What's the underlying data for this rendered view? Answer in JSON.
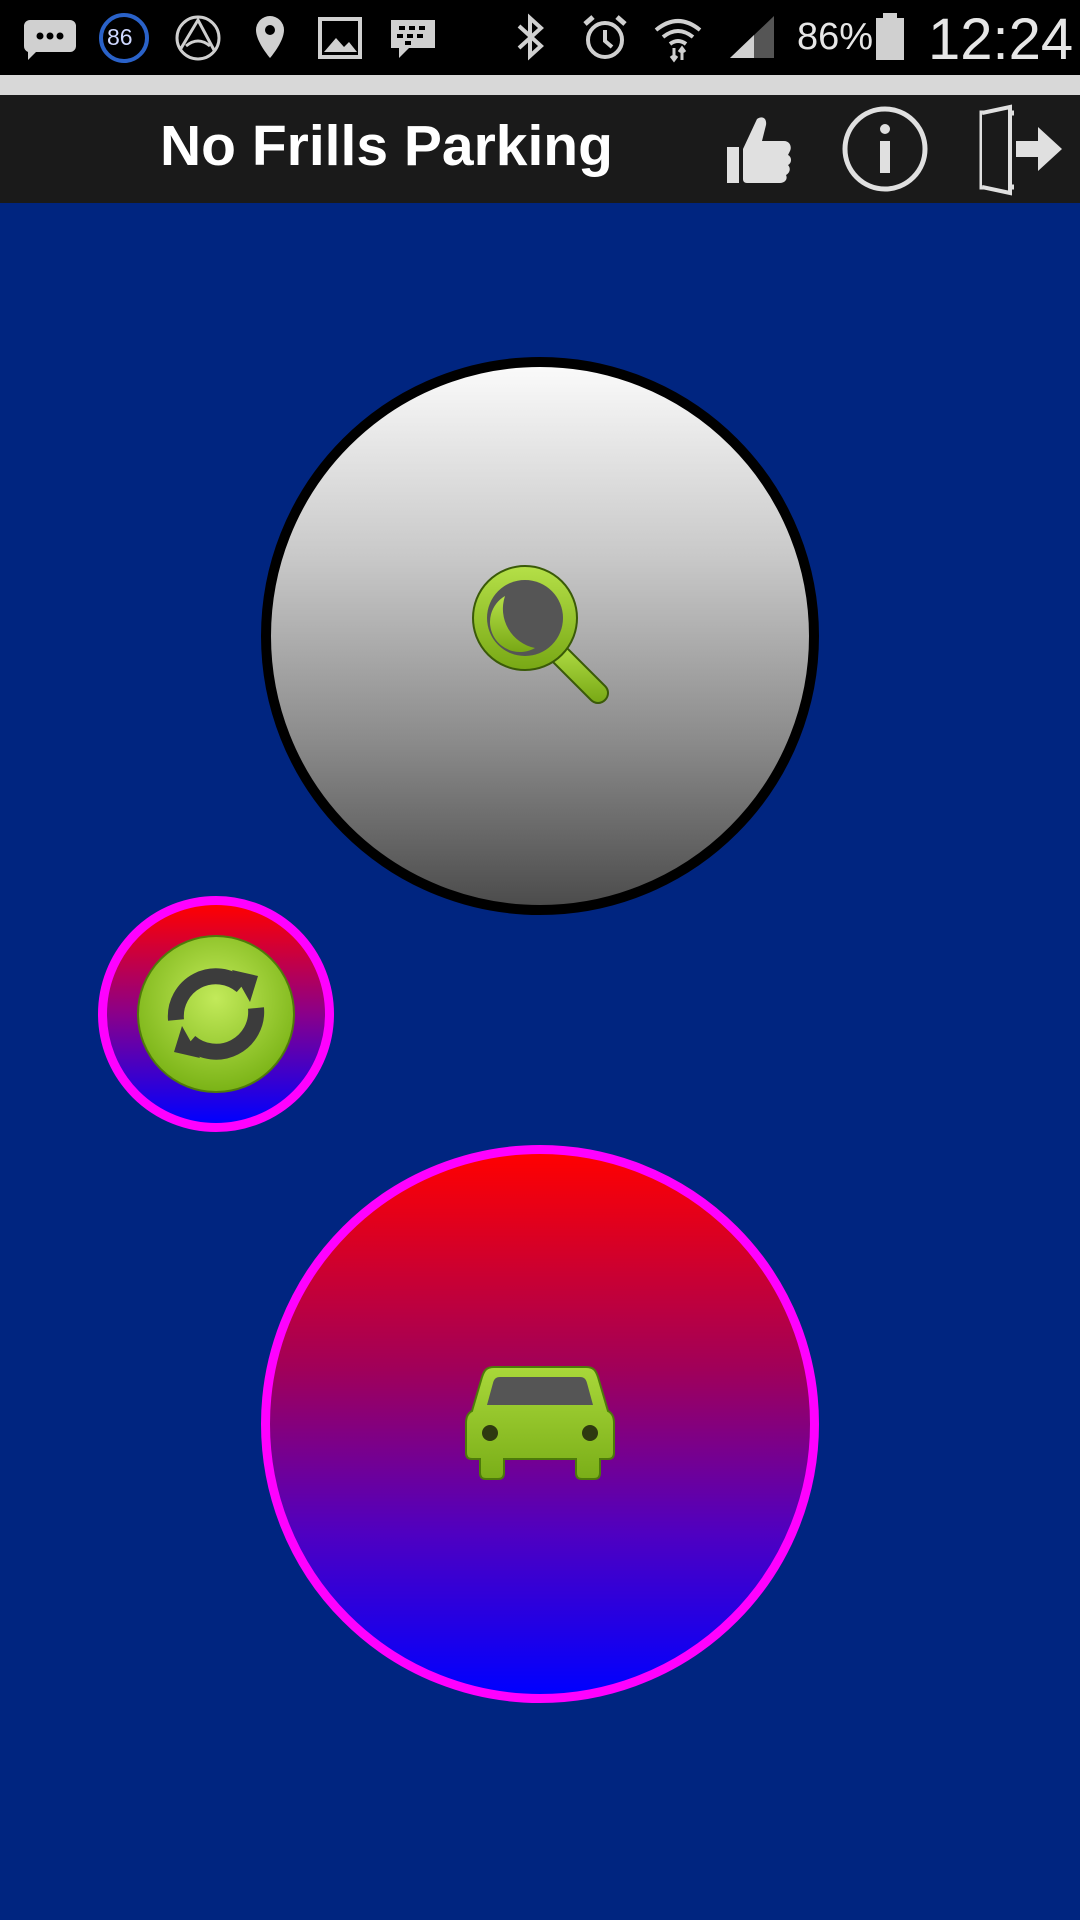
{
  "status_bar": {
    "notification_badge": "86",
    "battery_percent": "86%",
    "time": "12:24",
    "icons": [
      "messages-icon",
      "count-badge-icon",
      "arc-app-icon",
      "location-icon",
      "gallery-icon",
      "blackberry-icon",
      "bluetooth-icon",
      "alarm-icon",
      "wifi-icon",
      "signal-icon",
      "battery-icon"
    ]
  },
  "action_bar": {
    "title": "No Frills Parking",
    "actions": [
      "thumbs-up-icon",
      "info-icon",
      "exit-icon"
    ]
  },
  "main": {
    "buttons": [
      "search-button",
      "refresh-button",
      "park-car-button"
    ],
    "icons": [
      "magnifier-icon",
      "refresh-icon",
      "car-icon"
    ]
  },
  "colors": {
    "background": "#002580",
    "accent_green": "#8cc020",
    "magenta_border": "#ff00ff",
    "red": "#ff0000",
    "blue": "#0000ff"
  }
}
